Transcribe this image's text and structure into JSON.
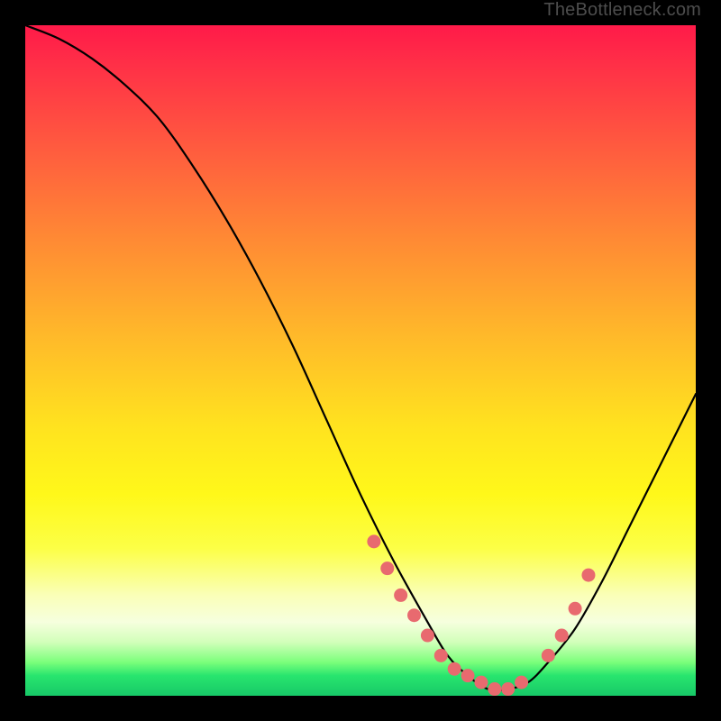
{
  "watermark": "TheBottleneck.com",
  "chart_data": {
    "type": "line",
    "title": "",
    "xlabel": "",
    "ylabel": "",
    "xlim": [
      0,
      100
    ],
    "ylim": [
      0,
      100
    ],
    "grid": false,
    "legend": false,
    "series": [
      {
        "name": "bottleneck-curve",
        "x": [
          0,
          5,
          10,
          15,
          20,
          25,
          30,
          35,
          40,
          45,
          50,
          55,
          60,
          63,
          66,
          69,
          72,
          75,
          78,
          82,
          86,
          90,
          94,
          98,
          100
        ],
        "y": [
          100,
          98,
          95,
          91,
          86,
          79,
          71,
          62,
          52,
          41,
          30,
          20,
          11,
          6,
          3,
          1,
          1,
          2,
          5,
          10,
          17,
          25,
          33,
          41,
          45
        ]
      }
    ],
    "markers": {
      "name": "highlight-points",
      "color": "#e86a6f",
      "x": [
        52,
        54,
        56,
        58,
        60,
        62,
        64,
        66,
        68,
        70,
        72,
        74,
        78,
        80,
        82,
        84
      ],
      "y": [
        23,
        19,
        15,
        12,
        9,
        6,
        4,
        3,
        2,
        1,
        1,
        2,
        6,
        9,
        13,
        18
      ]
    },
    "background_gradient": {
      "top": "#ff1a49",
      "mid": "#ffe31f",
      "bottom": "#17c867"
    }
  }
}
